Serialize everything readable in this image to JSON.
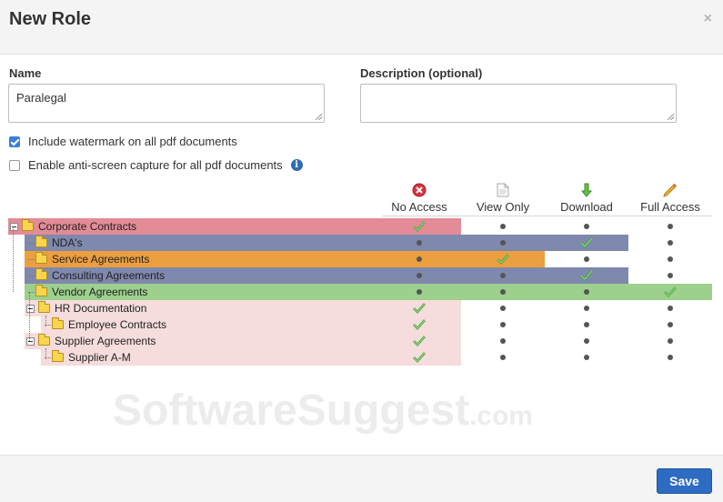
{
  "dialog": {
    "title": "New Role",
    "close_label": "×"
  },
  "form": {
    "name_label": "Name",
    "name_value": "Paralegal",
    "description_label": "Description (optional)",
    "description_value": ""
  },
  "options": [
    {
      "label": "Include watermark on all pdf documents",
      "checked": true
    },
    {
      "label": "Enable anti-screen capture for all pdf documents",
      "checked": false,
      "has_info": true
    }
  ],
  "columns": [
    {
      "label": "No Access",
      "icon": "no-access-icon"
    },
    {
      "label": "View Only",
      "icon": "document-icon"
    },
    {
      "label": "Download",
      "icon": "download-arrow-icon"
    },
    {
      "label": "Full Access",
      "icon": "pencil-icon"
    }
  ],
  "tree": [
    {
      "label": "Corporate Contracts",
      "depth": 0,
      "expandable": true,
      "access": "No Access",
      "color": "#e38b96"
    },
    {
      "label": "NDA's",
      "depth": 1,
      "expandable": false,
      "access": "Download",
      "color": "#7f88ad"
    },
    {
      "label": "Service Agreements",
      "depth": 1,
      "expandable": false,
      "access": "View Only",
      "color": "#ec9f3f"
    },
    {
      "label": "Consulting Agreements",
      "depth": 1,
      "expandable": false,
      "access": "Download",
      "color": "#7f88ad"
    },
    {
      "label": "Vendor Agreements",
      "depth": 1,
      "expandable": false,
      "access": "Full Access",
      "color": "#9cd08c"
    },
    {
      "label": "HR Documentation",
      "depth": 1,
      "expandable": true,
      "access": "No Access",
      "color": "#f6dcdc"
    },
    {
      "label": "Employee Contracts",
      "depth": 2,
      "expandable": false,
      "access": "No Access",
      "color": "#f6dcdc"
    },
    {
      "label": "Supplier Agreements",
      "depth": 1,
      "expandable": true,
      "access": "No Access",
      "color": "#f6dcdc"
    },
    {
      "label": "Supplier A-M",
      "depth": 2,
      "expandable": false,
      "access": "No Access",
      "color": "#f6dcdc"
    }
  ],
  "watermark": {
    "main": "SoftwareSuggest",
    "suffix": ".com"
  },
  "footer": {
    "save_label": "Save"
  },
  "colors": {
    "primary": "#2e6bc2",
    "check": "#5cb85c",
    "no_access": "#d9333f"
  }
}
